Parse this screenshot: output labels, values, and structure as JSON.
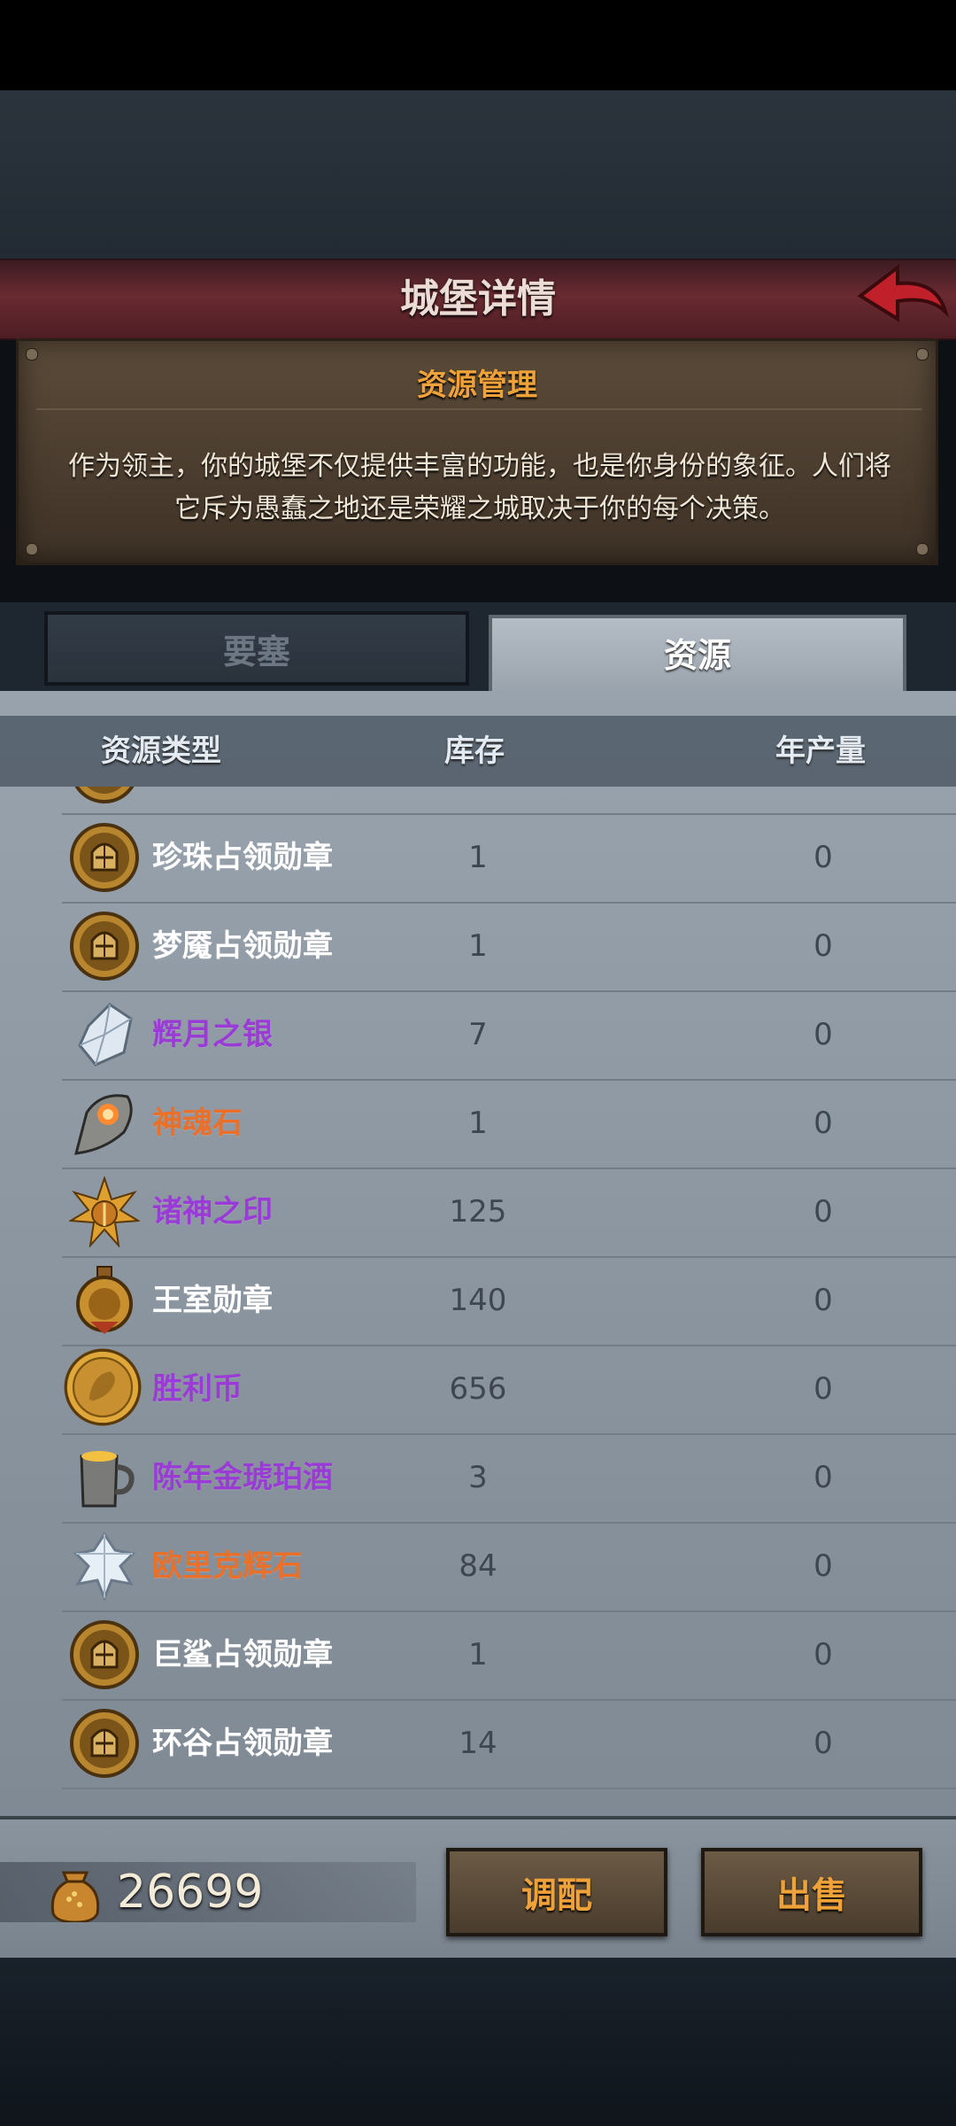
{
  "window": {
    "title": "城堡详情"
  },
  "info": {
    "heading": "资源管理",
    "line1": "作为领主，你的城堡不仅提供丰富的功能，也是你身份的象征。人们将",
    "line2": "它斥为愚蠢之地还是荣耀之城取决于你的每个决策。"
  },
  "tabs": [
    {
      "label": "要塞",
      "active": false
    },
    {
      "label": "资源",
      "active": true
    }
  ],
  "columns": {
    "type": "资源类型",
    "stock": "库存",
    "annual": "年产量"
  },
  "rows": [
    {
      "name": "",
      "stock": "",
      "annual": "",
      "icon": "helmet-medal-icon",
      "color": "#ffffff"
    },
    {
      "name": "珍珠占领勋章",
      "stock": "1",
      "annual": "0",
      "icon": "helmet-medal-icon",
      "color": "#ffffff"
    },
    {
      "name": "梦魇占领勋章",
      "stock": "1",
      "annual": "0",
      "icon": "helmet-medal-icon",
      "color": "#ffffff"
    },
    {
      "name": "辉月之银",
      "stock": "7",
      "annual": "0",
      "icon": "silver-crystal-icon",
      "color": "#9a3bd6"
    },
    {
      "name": "神魂石",
      "stock": "1",
      "annual": "0",
      "icon": "soul-stone-icon",
      "color": "#e8702a"
    },
    {
      "name": "诸神之印",
      "stock": "125",
      "annual": "0",
      "icon": "sun-seal-icon",
      "color": "#9a3bd6"
    },
    {
      "name": "王室勋章",
      "stock": "140",
      "annual": "0",
      "icon": "royal-medal-icon",
      "color": "#ffffff"
    },
    {
      "name": "胜利币",
      "stock": "656",
      "annual": "0",
      "icon": "victory-coin-icon",
      "color": "#9a3bd6"
    },
    {
      "name": "陈年金琥珀酒",
      "stock": "3",
      "annual": "0",
      "icon": "amber-mug-icon",
      "color": "#9a3bd6"
    },
    {
      "name": "欧里克辉石",
      "stock": "84",
      "annual": "0",
      "icon": "crystal-shard-icon",
      "color": "#e8702a"
    },
    {
      "name": "巨鲨占领勋章",
      "stock": "1",
      "annual": "0",
      "icon": "helmet-medal-icon",
      "color": "#ffffff"
    },
    {
      "name": "环谷占领勋章",
      "stock": "14",
      "annual": "0",
      "icon": "helmet-medal-icon",
      "color": "#ffffff"
    }
  ],
  "footer": {
    "gold": "26699",
    "gold_icon": "gold-sack-icon",
    "adjust_label": "调配",
    "sell_label": "出售"
  }
}
